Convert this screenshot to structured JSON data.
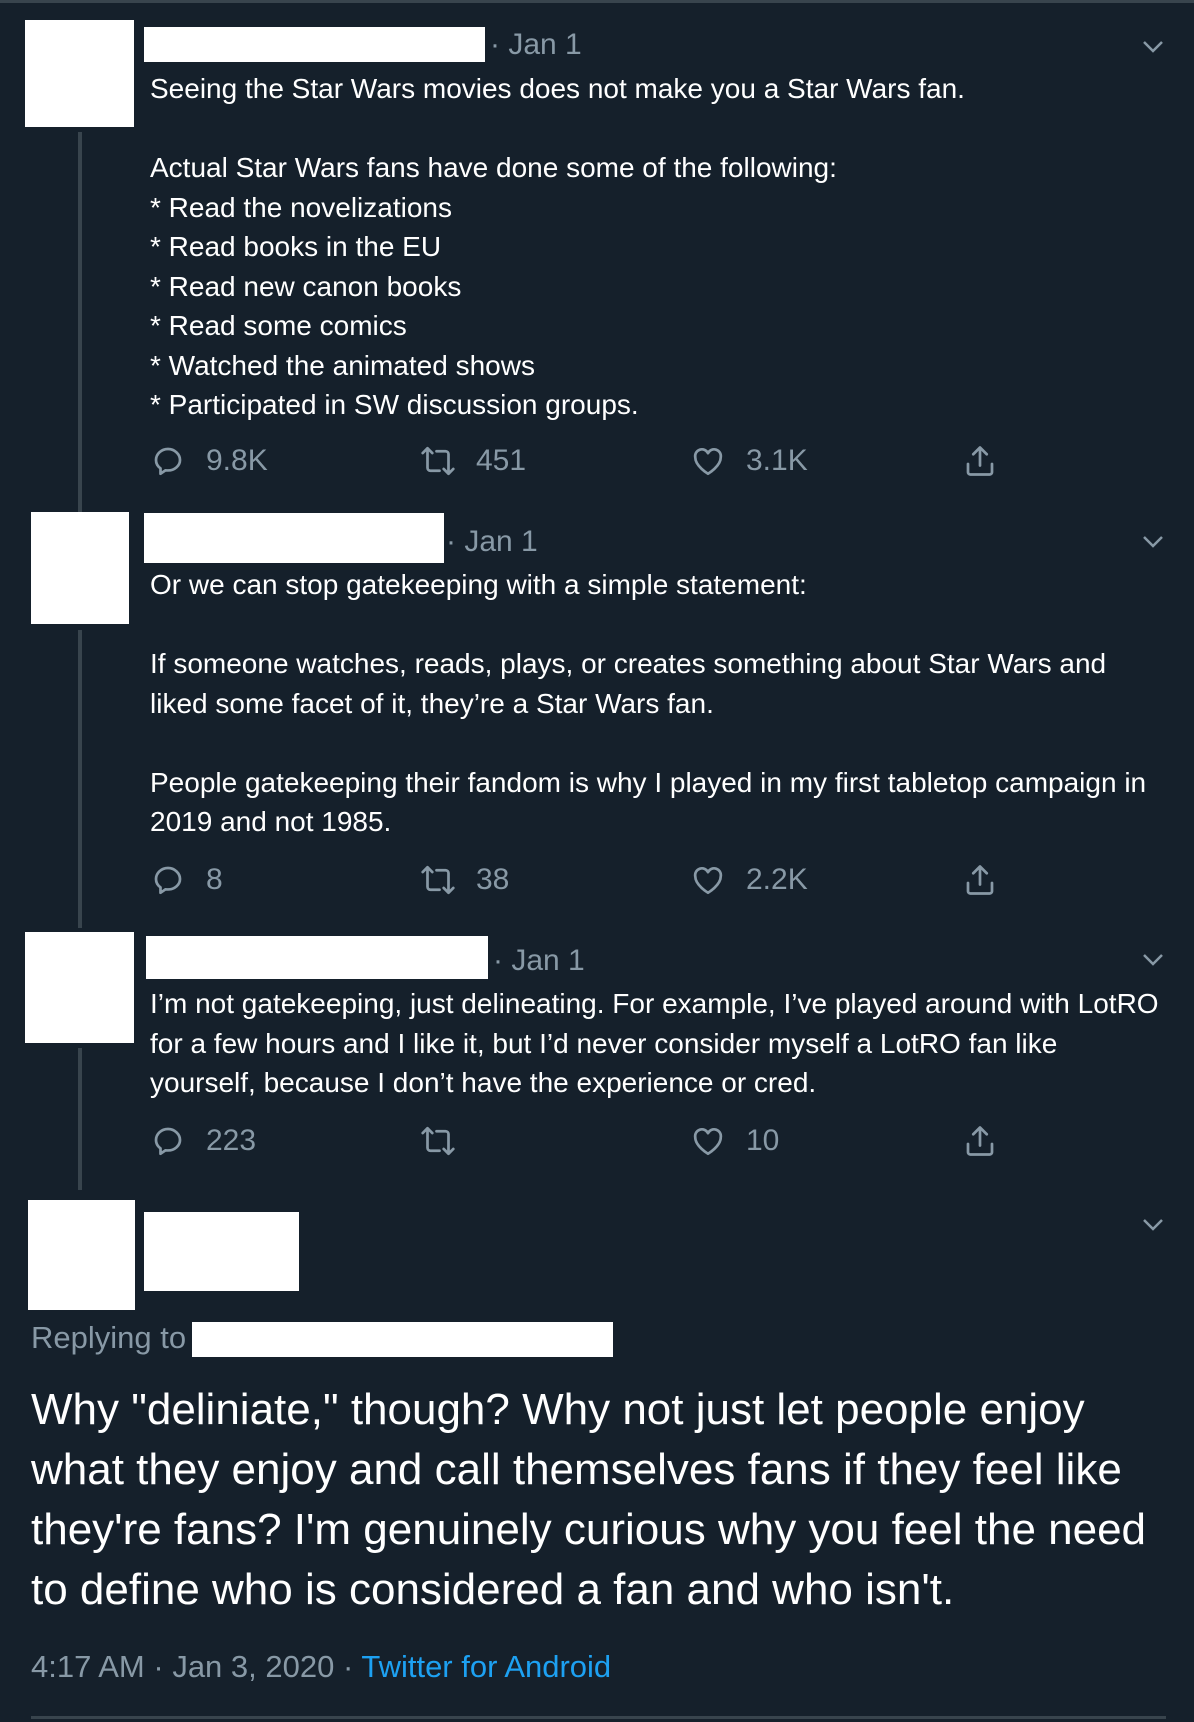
{
  "tweets": [
    {
      "date": "· Jan 1",
      "text": "Seeing the Star Wars movies does not make you a Star Wars fan.\n\nActual Star Wars fans have done some of the following:\n* Read the novelizations\n* Read books in the EU\n* Read new canon books\n* Read some comics\n* Watched the animated shows\n* Participated in SW discussion groups.",
      "replies": "9.8K",
      "retweets": "451",
      "likes": "3.1K"
    },
    {
      "date": "· Jan 1",
      "text": "Or we can stop gatekeeping with a simple statement:\n\nIf someone watches, reads, plays, or creates something about Star Wars and liked some facet of it, they’re a Star Wars fan.\n\nPeople gatekeeping their fandom is why I played in my first tabletop campaign in 2019 and not 1985.",
      "replies": "8",
      "retweets": "38",
      "likes": "2.2K"
    },
    {
      "date": "· Jan 1",
      "text": "I’m not gatekeeping, just delineating. For example, I’ve played around with LotRO for a few hours and I like it, but I’d never consider myself a LotRO fan like yourself, because I don’t have the experience or cred.",
      "replies": "223",
      "retweets": "",
      "likes": "10"
    }
  ],
  "main_tweet": {
    "replying_to_label": "Replying to",
    "text": "Why \"deliniate,\" though? Why not just let people enjoy what they enjoy and call themselves fans if they feel like they're fans? I'm genuinely curious why you feel the need to define who is considered a fan and who isn't.",
    "time": "4:17 AM",
    "sep1": " · ",
    "date": "Jan 3, 2020",
    "sep2": " · ",
    "source": "Twitter for Android"
  },
  "icons": {
    "reply": "reply-icon",
    "retweet": "retweet-icon",
    "like": "heart-icon",
    "share": "share-icon",
    "menu": "chevron-down-icon"
  },
  "colors": {
    "background": "#15202b",
    "secondary_text": "#8899a6",
    "link": "#1da1f2",
    "divider": "#38444d"
  }
}
